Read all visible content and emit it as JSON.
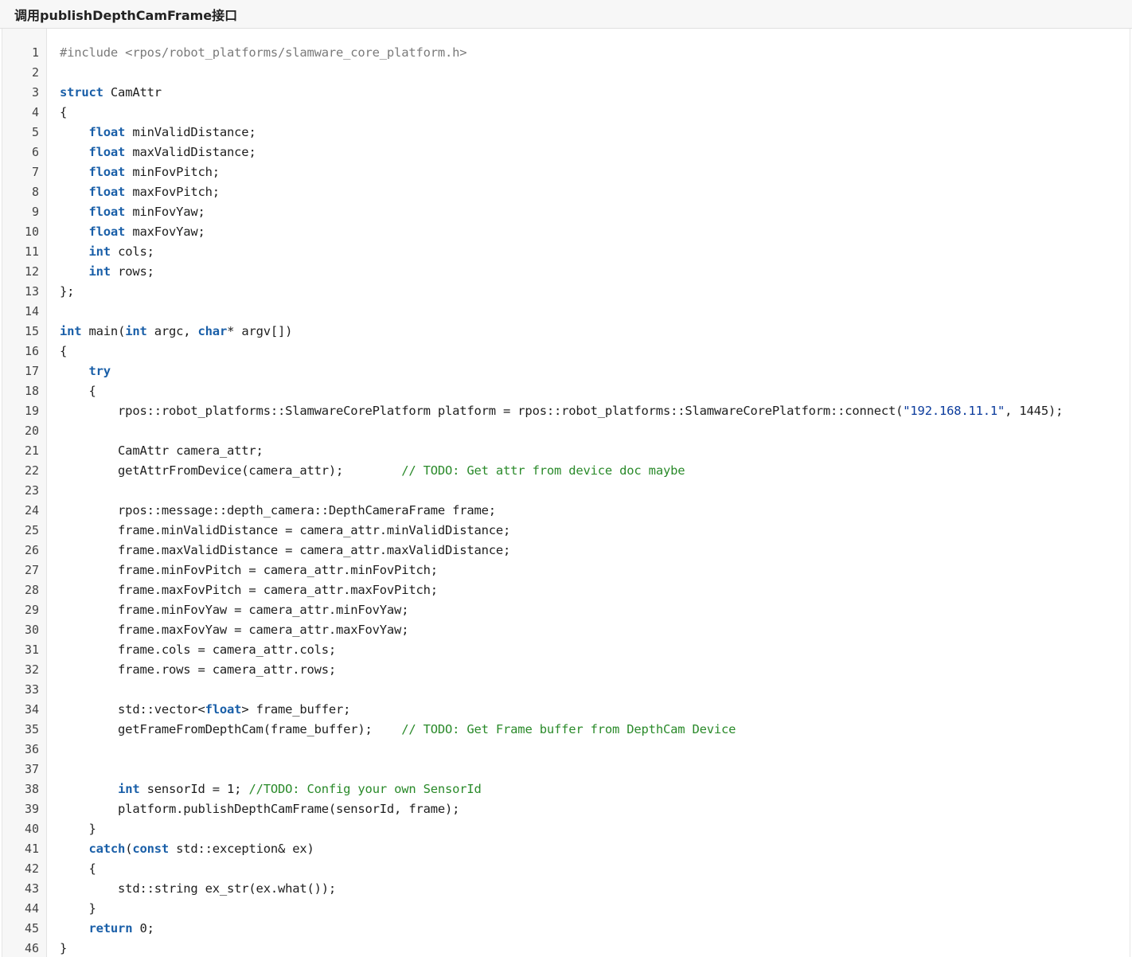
{
  "header": {
    "title": "调用publishDepthCamFrame接口"
  },
  "code": {
    "lines": [
      [
        [
          "pp",
          "#include <rpos/robot_platforms/slamware_core_platform.h>"
        ]
      ],
      [],
      [
        [
          "kw",
          "struct"
        ],
        [
          "t",
          " CamAttr"
        ]
      ],
      [
        [
          "t",
          "{"
        ]
      ],
      [
        [
          "t",
          "    "
        ],
        [
          "kw",
          "float"
        ],
        [
          "t",
          " minValidDistance;"
        ]
      ],
      [
        [
          "t",
          "    "
        ],
        [
          "kw",
          "float"
        ],
        [
          "t",
          " maxValidDistance;"
        ]
      ],
      [
        [
          "t",
          "    "
        ],
        [
          "kw",
          "float"
        ],
        [
          "t",
          " minFovPitch;"
        ]
      ],
      [
        [
          "t",
          "    "
        ],
        [
          "kw",
          "float"
        ],
        [
          "t",
          " maxFovPitch;"
        ]
      ],
      [
        [
          "t",
          "    "
        ],
        [
          "kw",
          "float"
        ],
        [
          "t",
          " minFovYaw;"
        ]
      ],
      [
        [
          "t",
          "    "
        ],
        [
          "kw",
          "float"
        ],
        [
          "t",
          " maxFovYaw;"
        ]
      ],
      [
        [
          "t",
          "    "
        ],
        [
          "kw",
          "int"
        ],
        [
          "t",
          " cols;"
        ]
      ],
      [
        [
          "t",
          "    "
        ],
        [
          "kw",
          "int"
        ],
        [
          "t",
          " rows;"
        ]
      ],
      [
        [
          "t",
          "};"
        ]
      ],
      [],
      [
        [
          "kw",
          "int"
        ],
        [
          "t",
          " main("
        ],
        [
          "kw",
          "int"
        ],
        [
          "t",
          " argc, "
        ],
        [
          "kw",
          "char"
        ],
        [
          "t",
          "* argv[])"
        ]
      ],
      [
        [
          "t",
          "{"
        ]
      ],
      [
        [
          "t",
          "    "
        ],
        [
          "kw",
          "try"
        ]
      ],
      [
        [
          "t",
          "    {"
        ]
      ],
      [
        [
          "t",
          "        rpos::robot_platforms::SlamwareCorePlatform platform = rpos::robot_platforms::SlamwareCorePlatform::connect("
        ],
        [
          "str",
          "\"192.168.11.1\""
        ],
        [
          "t",
          ", 1445);"
        ]
      ],
      [],
      [
        [
          "t",
          "        CamAttr camera_attr;"
        ]
      ],
      [
        [
          "t",
          "        getAttrFromDevice(camera_attr);        "
        ],
        [
          "cm",
          "// TODO: Get attr from device doc maybe"
        ]
      ],
      [],
      [
        [
          "t",
          "        rpos::message::depth_camera::DepthCameraFrame frame;"
        ]
      ],
      [
        [
          "t",
          "        frame.minValidDistance = camera_attr.minValidDistance;"
        ]
      ],
      [
        [
          "t",
          "        frame.maxValidDistance = camera_attr.maxValidDistance;"
        ]
      ],
      [
        [
          "t",
          "        frame.minFovPitch = camera_attr.minFovPitch;"
        ]
      ],
      [
        [
          "t",
          "        frame.maxFovPitch = camera_attr.maxFovPitch;"
        ]
      ],
      [
        [
          "t",
          "        frame.minFovYaw = camera_attr.minFovYaw;"
        ]
      ],
      [
        [
          "t",
          "        frame.maxFovYaw = camera_attr.maxFovYaw;"
        ]
      ],
      [
        [
          "t",
          "        frame.cols = camera_attr.cols;"
        ]
      ],
      [
        [
          "t",
          "        frame.rows = camera_attr.rows;"
        ]
      ],
      [],
      [
        [
          "t",
          "        std::vector<"
        ],
        [
          "kw",
          "float"
        ],
        [
          "t",
          "> frame_buffer;"
        ]
      ],
      [
        [
          "t",
          "        getFrameFromDepthCam(frame_buffer);    "
        ],
        [
          "cm",
          "// TODO: Get Frame buffer from DepthCam Device"
        ]
      ],
      [],
      [],
      [
        [
          "t",
          "        "
        ],
        [
          "kw",
          "int"
        ],
        [
          "t",
          " sensorId = 1; "
        ],
        [
          "cm",
          "//TODO: Config your own SensorId"
        ]
      ],
      [
        [
          "t",
          "        platform.publishDepthCamFrame(sensorId, frame);"
        ]
      ],
      [
        [
          "t",
          "    }"
        ]
      ],
      [
        [
          "t",
          "    "
        ],
        [
          "kw",
          "catch"
        ],
        [
          "t",
          "("
        ],
        [
          "kw",
          "const"
        ],
        [
          "t",
          " std::exception& ex)"
        ]
      ],
      [
        [
          "t",
          "    {"
        ]
      ],
      [
        [
          "t",
          "        std::string ex_str(ex.what());"
        ]
      ],
      [
        [
          "t",
          "    }"
        ]
      ],
      [
        [
          "t",
          "    "
        ],
        [
          "kw",
          "return"
        ],
        [
          "t",
          " 0;"
        ]
      ],
      [
        [
          "t",
          "}"
        ]
      ]
    ]
  }
}
